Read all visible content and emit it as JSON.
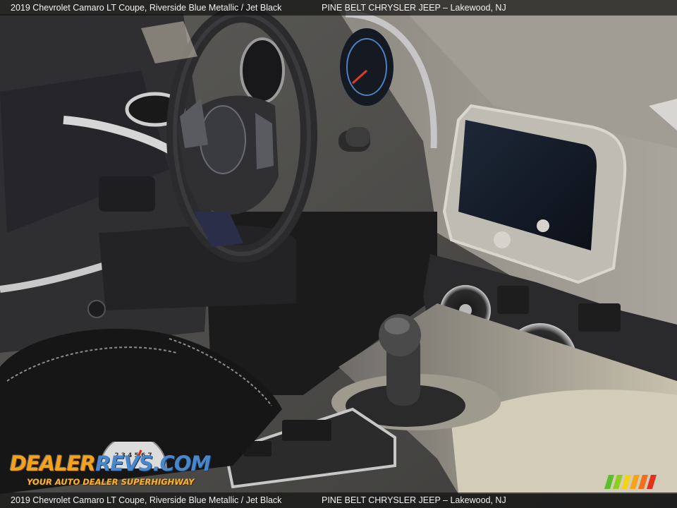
{
  "caption": {
    "top_left": "2019 Chevrolet Camaro LT Coupe,  Riverside Blue Metallic / Jet Black",
    "top_right": "PINE BELT CHRYSLER JEEP – Lakewood, NJ",
    "bottom_left": "2019 Chevrolet Camaro LT Coupe,  Riverside Blue Metallic / Jet Black",
    "bottom_right": "PINE BELT CHRYSLER JEEP – Lakewood, NJ"
  },
  "watermark": {
    "brand_a": "DEALER",
    "brand_b": "REVS",
    "brand_c": ".COM",
    "tagline": "YOUR AUTO DEALER SUPERHIGHWAY",
    "gauge_digits": "2 3 4 5 6 7"
  },
  "colors": {
    "caption_bg": "#141414",
    "caption_text": "#f2f2f2",
    "brand_orange": "#f2a21b",
    "brand_blue": "#4a86c8",
    "stripe_colors": [
      "#5bbf2a",
      "#8fce1e",
      "#f5d21a",
      "#f7a41c",
      "#f0711c",
      "#e2321c"
    ]
  },
  "photo": {
    "subject": "car-interior",
    "icons": [
      "steering-wheel-icon",
      "gear-shifter-icon",
      "air-vent-icon",
      "touchscreen-icon"
    ]
  }
}
